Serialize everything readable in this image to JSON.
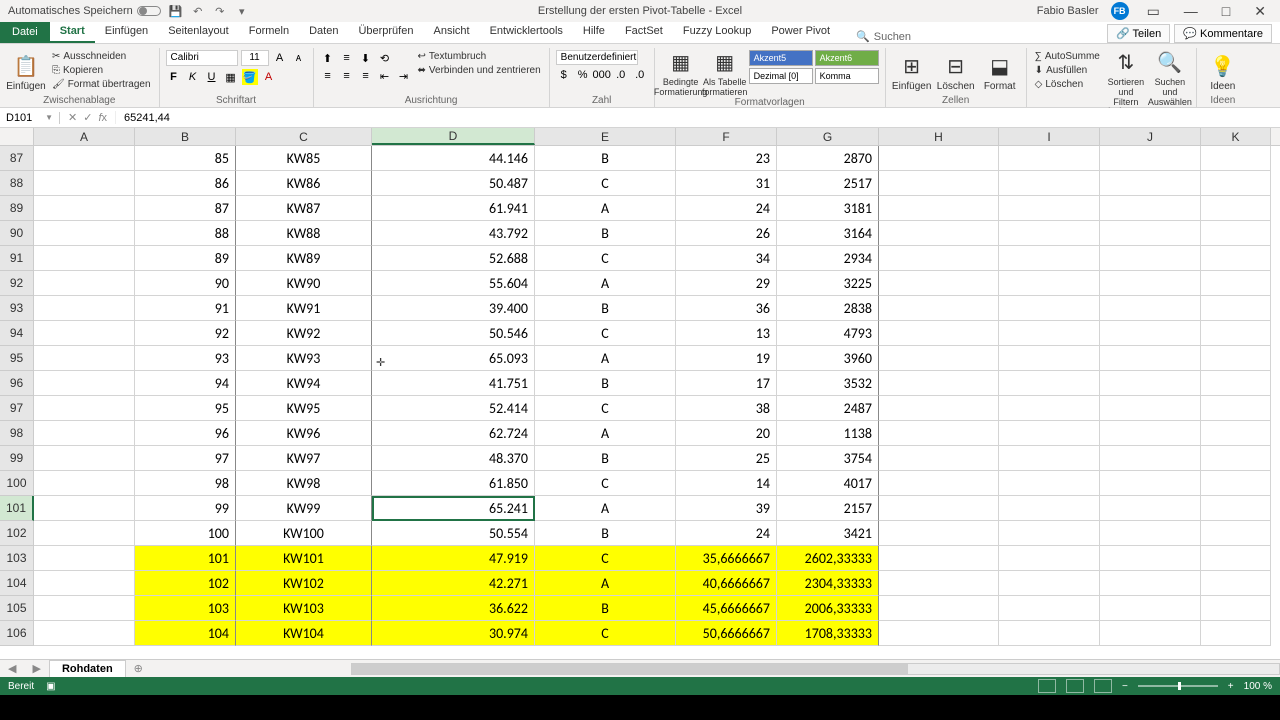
{
  "titlebar": {
    "autoSave": "Automatisches Speichern",
    "docTitle": "Erstellung der ersten Pivot-Tabelle  -  Excel",
    "userName": "Fabio Basler",
    "userInitials": "FB"
  },
  "tabs": {
    "file": "Datei",
    "items": [
      "Start",
      "Einfügen",
      "Seitenlayout",
      "Formeln",
      "Daten",
      "Überprüfen",
      "Ansicht",
      "Entwicklertools",
      "Hilfe",
      "FactSet",
      "Fuzzy Lookup",
      "Power Pivot"
    ],
    "activeIndex": 0,
    "searchLabel": "Suchen",
    "share": "Teilen",
    "comments": "Kommentare"
  },
  "ribbon": {
    "clipboard": {
      "paste": "Einfügen",
      "cut": "Ausschneiden",
      "copy": "Kopieren",
      "formatPainter": "Format übertragen",
      "group": "Zwischenablage"
    },
    "font": {
      "name": "Calibri",
      "size": "11",
      "group": "Schriftart"
    },
    "alignment": {
      "wrap": "Textumbruch",
      "merge": "Verbinden und zentrieren",
      "group": "Ausrichtung"
    },
    "number": {
      "format": "Benutzerdefiniert",
      "group": "Zahl"
    },
    "styles": {
      "condFmt": "Bedingte Formatierung",
      "asTable": "Als Tabelle formatieren",
      "accent5": "Akzent5",
      "accent6": "Akzent6",
      "dezimal": "Dezimal [0]",
      "komma": "Komma",
      "group": "Formatvorlagen"
    },
    "cells": {
      "insert": "Einfügen",
      "delete": "Löschen",
      "format": "Format",
      "group": "Zellen"
    },
    "editing": {
      "autosum": "AutoSumme",
      "fill": "Ausfüllen",
      "clear": "Löschen",
      "sortFilter": "Sortieren und Filtern",
      "findSelect": "Suchen und Auswählen",
      "group": "Bearbeiten"
    },
    "ideas": {
      "label": "Ideen",
      "group": "Ideen"
    }
  },
  "nameBox": "D101",
  "formulaBar": "65241,44",
  "columns": [
    "A",
    "B",
    "C",
    "D",
    "E",
    "F",
    "G",
    "H",
    "I",
    "J",
    "K"
  ],
  "selectedCol": "D",
  "selectedRow": 101,
  "rows": [
    {
      "n": 87,
      "b": "85",
      "c": "KW85",
      "d": "44.146",
      "e": "B",
      "f": "23",
      "g": "2870",
      "hl": false
    },
    {
      "n": 88,
      "b": "86",
      "c": "KW86",
      "d": "50.487",
      "e": "C",
      "f": "31",
      "g": "2517",
      "hl": false
    },
    {
      "n": 89,
      "b": "87",
      "c": "KW87",
      "d": "61.941",
      "e": "A",
      "f": "24",
      "g": "3181",
      "hl": false
    },
    {
      "n": 90,
      "b": "88",
      "c": "KW88",
      "d": "43.792",
      "e": "B",
      "f": "26",
      "g": "3164",
      "hl": false
    },
    {
      "n": 91,
      "b": "89",
      "c": "KW89",
      "d": "52.688",
      "e": "C",
      "f": "34",
      "g": "2934",
      "hl": false
    },
    {
      "n": 92,
      "b": "90",
      "c": "KW90",
      "d": "55.604",
      "e": "A",
      "f": "29",
      "g": "3225",
      "hl": false
    },
    {
      "n": 93,
      "b": "91",
      "c": "KW91",
      "d": "39.400",
      "e": "B",
      "f": "36",
      "g": "2838",
      "hl": false
    },
    {
      "n": 94,
      "b": "92",
      "c": "KW92",
      "d": "50.546",
      "e": "C",
      "f": "13",
      "g": "4793",
      "hl": false
    },
    {
      "n": 95,
      "b": "93",
      "c": "KW93",
      "d": "65.093",
      "e": "A",
      "f": "19",
      "g": "3960",
      "hl": false
    },
    {
      "n": 96,
      "b": "94",
      "c": "KW94",
      "d": "41.751",
      "e": "B",
      "f": "17",
      "g": "3532",
      "hl": false
    },
    {
      "n": 97,
      "b": "95",
      "c": "KW95",
      "d": "52.414",
      "e": "C",
      "f": "38",
      "g": "2487",
      "hl": false
    },
    {
      "n": 98,
      "b": "96",
      "c": "KW96",
      "d": "62.724",
      "e": "A",
      "f": "20",
      "g": "1138",
      "hl": false
    },
    {
      "n": 99,
      "b": "97",
      "c": "KW97",
      "d": "48.370",
      "e": "B",
      "f": "25",
      "g": "3754",
      "hl": false
    },
    {
      "n": 100,
      "b": "98",
      "c": "KW98",
      "d": "61.850",
      "e": "C",
      "f": "14",
      "g": "4017",
      "hl": false
    },
    {
      "n": 101,
      "b": "99",
      "c": "KW99",
      "d": "65.241",
      "e": "A",
      "f": "39",
      "g": "2157",
      "hl": false
    },
    {
      "n": 102,
      "b": "100",
      "c": "KW100",
      "d": "50.554",
      "e": "B",
      "f": "24",
      "g": "3421",
      "hl": false
    },
    {
      "n": 103,
      "b": "101",
      "c": "KW101",
      "d": "47.919",
      "e": "C",
      "f": "35,6666667",
      "g": "2602,33333",
      "hl": true
    },
    {
      "n": 104,
      "b": "102",
      "c": "KW102",
      "d": "42.271",
      "e": "A",
      "f": "40,6666667",
      "g": "2304,33333",
      "hl": true
    },
    {
      "n": 105,
      "b": "103",
      "c": "KW103",
      "d": "36.622",
      "e": "B",
      "f": "45,6666667",
      "g": "2006,33333",
      "hl": true
    },
    {
      "n": 106,
      "b": "104",
      "c": "KW104",
      "d": "30.974",
      "e": "C",
      "f": "50,6666667",
      "g": "1708,33333",
      "hl": true
    }
  ],
  "sheetTab": "Rohdaten",
  "status": {
    "ready": "Bereit",
    "zoom": "100 %"
  }
}
